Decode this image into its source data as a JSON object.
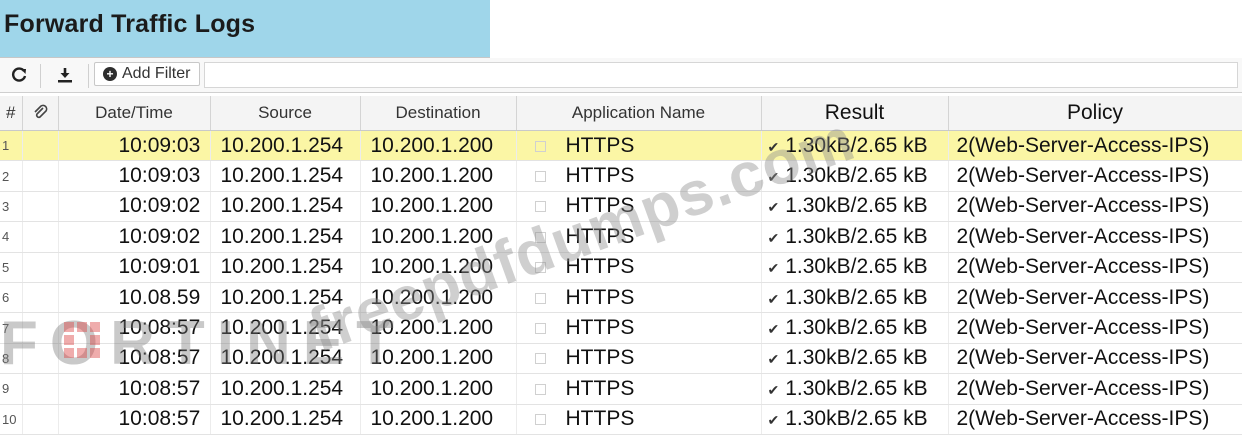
{
  "header": {
    "title": "Forward Traffic Logs"
  },
  "toolbar": {
    "refresh_icon": "refresh-icon",
    "download_icon": "download-icon",
    "add_filter_label": "Add Filter"
  },
  "table": {
    "columns": [
      "#",
      "",
      "Date/Time",
      "Source",
      "Destination",
      "Application Name",
      "Result",
      "Policy"
    ],
    "rows": [
      {
        "num": "1",
        "time": "10:09:03",
        "source": "10.200.1.254",
        "destination": "10.200.1.200",
        "app": "HTTPS",
        "result": "1.30kB/2.65 kB",
        "policy": "2(Web-Server-Access-IPS)"
      },
      {
        "num": "2",
        "time": "10:09:03",
        "source": "10.200.1.254",
        "destination": "10.200.1.200",
        "app": "HTTPS",
        "result": "1.30kB/2.65 kB",
        "policy": "2(Web-Server-Access-IPS)"
      },
      {
        "num": "3",
        "time": "10:09:02",
        "source": "10.200.1.254",
        "destination": "10.200.1.200",
        "app": "HTTPS",
        "result": "1.30kB/2.65 kB",
        "policy": "2(Web-Server-Access-IPS)"
      },
      {
        "num": "4",
        "time": "10:09:02",
        "source": "10.200.1.254",
        "destination": "10.200.1.200",
        "app": "HTTPS",
        "result": "1.30kB/2.65 kB",
        "policy": "2(Web-Server-Access-IPS)"
      },
      {
        "num": "5",
        "time": "10:09:01",
        "source": "10.200.1.254",
        "destination": "10.200.1.200",
        "app": "HTTPS",
        "result": "1.30kB/2.65 kB",
        "policy": "2(Web-Server-Access-IPS)"
      },
      {
        "num": "6",
        "time": "10.08.59",
        "source": "10.200.1.254",
        "destination": "10.200.1.200",
        "app": "HTTPS",
        "result": "1.30kB/2.65 kB",
        "policy": "2(Web-Server-Access-IPS)"
      },
      {
        "num": "7",
        "time": "10:08:57",
        "source": "10.200.1.254",
        "destination": "10.200.1.200",
        "app": "HTTPS",
        "result": "1.30kB/2.65 kB",
        "policy": "2(Web-Server-Access-IPS)"
      },
      {
        "num": "8",
        "time": "10:08:57",
        "source": "10.200.1.254",
        "destination": "10.200.1.200",
        "app": "HTTPS",
        "result": "1.30kB/2.65 kB",
        "policy": "2(Web-Server-Access-IPS)"
      },
      {
        "num": "9",
        "time": "10:08:57",
        "source": "10.200.1.254",
        "destination": "10.200.1.200",
        "app": "HTTPS",
        "result": "1.30kB/2.65 kB",
        "policy": "2(Web-Server-Access-IPS)"
      },
      {
        "num": "10",
        "time": "10:08:57",
        "source": "10.200.1.254",
        "destination": "10.200.1.200",
        "app": "HTTPS",
        "result": "1.30kB/2.65 kB",
        "policy": "2(Web-Server-Access-IPS)"
      }
    ],
    "selected_row": 1
  },
  "watermark": {
    "text": "freepdfdumps.com",
    "brand": "FORTINET"
  },
  "colors": {
    "title_bg": "#9fd6ea",
    "selected_row": "#fbf6a5"
  }
}
